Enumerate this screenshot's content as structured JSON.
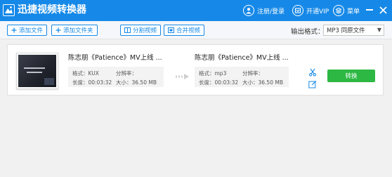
{
  "app": {
    "title": "迅捷视频转换器"
  },
  "titlebar": {
    "login_label": "注册/登录",
    "vip_label": "开通VIP",
    "menu_label": "菜单"
  },
  "toolbar": {
    "add_file": "添加文件",
    "add_folder": "添加文件夹",
    "split_video": "分割视频",
    "merge_video": "合并视频",
    "output_format_label": "输出格式：",
    "output_format_value": "MP3 同原文件"
  },
  "file_item": {
    "source": {
      "name": "陈志朋《Patience》MV上线 ...",
      "format_label": "格式：",
      "format": "KUX",
      "resolution_label": "分辨率：",
      "resolution": "",
      "duration_label": "长度：",
      "duration": "00:03:32",
      "size_label": "大小：",
      "size": "36.50 MB"
    },
    "target": {
      "name": "陈志朋《Patience》MV上线 ...",
      "format_label": "格式：",
      "format": "mp3",
      "resolution_label": "分辨率：",
      "resolution": "",
      "duration_label": "长度：",
      "duration": "00:03:32",
      "size_label": "大小：",
      "size": "36.50 MB"
    },
    "convert_label": "转换"
  },
  "colors": {
    "titlebar_bg": "#1689e8",
    "accent": "#1689e8",
    "convert_button": "#2db843"
  },
  "icons": {
    "logo": "app-logo-icon",
    "login": "user-icon",
    "vip": "vip-icon",
    "menu": "menu-icon",
    "cut": "scissors-icon",
    "edit": "edit-icon"
  }
}
